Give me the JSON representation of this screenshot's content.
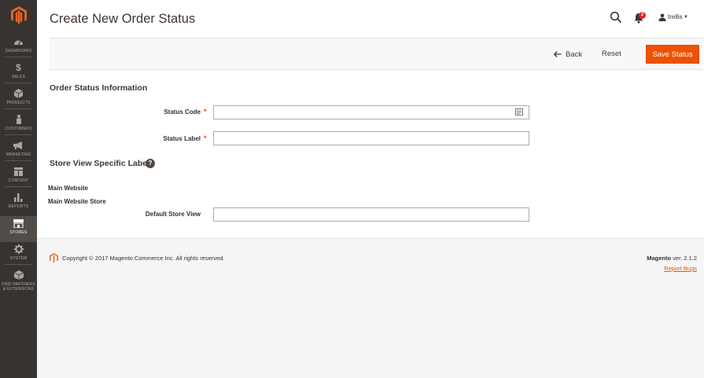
{
  "sidebar": {
    "items": [
      {
        "label": "DASHBOARD",
        "icon": "dashboard-icon"
      },
      {
        "label": "SALES",
        "icon": "dollar-icon"
      },
      {
        "label": "PRODUCTS",
        "icon": "cube-icon"
      },
      {
        "label": "CUSTOMERS",
        "icon": "person-icon"
      },
      {
        "label": "MARKETING",
        "icon": "megaphone-icon"
      },
      {
        "label": "CONTENT",
        "icon": "layout-icon"
      },
      {
        "label": "REPORTS",
        "icon": "bar-chart-icon"
      },
      {
        "label": "STORES",
        "icon": "storefront-icon"
      },
      {
        "label": "SYSTEM",
        "icon": "gear-icon"
      },
      {
        "label": "FIND PARTNERS",
        "label2": "& EXTENSIONS",
        "icon": "partners-cube-icon"
      }
    ],
    "active": "STORES"
  },
  "header": {
    "title": "Create New Order Status",
    "notification_count": "2",
    "user_name": "trellis"
  },
  "actions": {
    "back_label": "Back",
    "reset_label": "Reset",
    "save_label": "Save Status"
  },
  "form": {
    "section1_title": "Order Status Information",
    "status_code_label": "Status Code",
    "status_code_value": "",
    "status_label_label": "Status Label",
    "status_label_value": "",
    "section2_title": "Store View Specific Labels",
    "website_label": "Main Website",
    "store_label": "Main Website Store",
    "default_store_view_label": "Default Store View",
    "default_store_view_value": ""
  },
  "footer": {
    "copyright": "Copyright © 2017 Magento Commerce Inc. All rights reserved.",
    "brand": "Magento",
    "version": " ver. 2.1.2",
    "report_bugs": "Report Bugs"
  },
  "colors": {
    "accent": "#eb5202",
    "sidebar_bg": "#373330",
    "sidebar_active": "#524d49"
  }
}
